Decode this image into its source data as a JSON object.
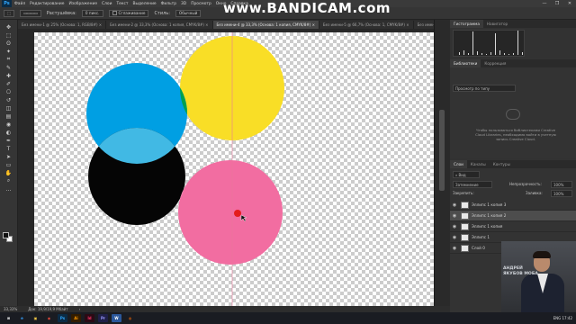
{
  "app": {
    "logo": "Ps",
    "window_controls": [
      "—",
      "❐",
      "✕"
    ]
  },
  "watermark": {
    "prefix": "www.",
    "brand": "BANDICAM",
    "suffix": ".com"
  },
  "menu": [
    "Файл",
    "Редактирование",
    "Изображение",
    "Слои",
    "Текст",
    "Выделение",
    "Фильтр",
    "3D",
    "Просмотр",
    "Окно",
    "Справка"
  ],
  "options_bar": {
    "tool_icon": "marquee-icon",
    "feather_label": "Растушёвка:",
    "feather_value": "0 пикс.",
    "style_label": "Стиль:",
    "style_value": "Обычный",
    "smooth_label": "Сглаживание",
    "select_mask": "Выделение и маска..."
  },
  "tabs": [
    {
      "label": "Без имени-1 @ 25% (Основа: 1, RGB/8#) ×",
      "active": false
    },
    {
      "label": "Без имени-2 @ 33,3% (Основа: 1 копия, CMYK/8#) ×",
      "active": false
    },
    {
      "label": "Без имени-4 @ 33,3% (Основа: 1 копия, CMYK/8#) ×",
      "active": true
    },
    {
      "label": "Без имени-5 @ 66,7% (Основа: 1, CMYK/8#) ×",
      "active": false
    },
    {
      "label": "Без имени-6 @ 66,7% (Основа: 1, CMYK/8#) ×",
      "active": false
    }
  ],
  "tools": [
    "move-icon",
    "marquee-icon",
    "lasso-icon",
    "magic-wand-icon",
    "crop-icon",
    "eyedropper-icon",
    "healing-icon",
    "brush-icon",
    "stamp-icon",
    "history-brush-icon",
    "eraser-icon",
    "gradient-icon",
    "blur-icon",
    "dodge-icon",
    "pen-icon",
    "type-icon",
    "path-select-icon",
    "shape-icon",
    "hand-icon",
    "zoom-icon",
    "more-icon"
  ],
  "tool_glyphs": [
    "✥",
    "⬚",
    "ʘ",
    "✦",
    "⌗",
    "✎",
    "✚",
    "✐",
    "⎔",
    "↺",
    "◫",
    "▤",
    "◉",
    "◐",
    "✒",
    "T",
    "➤",
    "▭",
    "✋",
    "⌕",
    "…"
  ],
  "circles": [
    {
      "name": "yellow",
      "color": "#f9de26"
    },
    {
      "name": "cyan",
      "color": "#009fe3"
    },
    {
      "name": "green-overlap",
      "color": "#00a050"
    },
    {
      "name": "black",
      "color": "#050505"
    },
    {
      "name": "light-cyan-overlap",
      "color": "#41b9e4"
    },
    {
      "name": "magenta",
      "color": "#f26da1"
    },
    {
      "name": "light-magenta-overlap",
      "color": "#f5a8c8"
    }
  ],
  "status": {
    "zoom": "33,33%",
    "doc": "Док: 19,9/19,9 Мбайт",
    "arrow": "›"
  },
  "panels": {
    "top_tabs": [
      "Гистограмма",
      "Навигатор"
    ],
    "libs_tabs": [
      "Библиотеки",
      "Коррекция"
    ],
    "libs_search_placeholder": "Просмотр по типу",
    "libs_message": "Чтобы пользоваться библиотеками Creative Cloud Libraries, необходимо войти в учетную запись Creative Cloud.",
    "layers_tabs": [
      "Слои",
      "Каналы",
      "Контуры"
    ],
    "layers_filter": "Вид",
    "blend_mode": "Затемнение",
    "opacity_label": "Непрозрачность:",
    "opacity_value": "100%",
    "lock_label": "Закрепить:",
    "fill_label": "Заливка:",
    "fill_value": "100%",
    "layers": [
      {
        "name": "Эллипс 1 копия 3",
        "selected": false
      },
      {
        "name": "Эллипс 1 копия 2",
        "selected": true
      },
      {
        "name": "Эллипс 1 копия",
        "selected": false
      },
      {
        "name": "Эллипс 1",
        "selected": false
      },
      {
        "name": "Слой 0",
        "selected": false
      }
    ]
  },
  "taskbar": {
    "apps": [
      {
        "label": "⊞",
        "color": "#ffffff",
        "bg": "#1a1c22"
      },
      {
        "label": "e",
        "color": "#35a0ff",
        "bg": "#1a1c22"
      },
      {
        "label": "▣",
        "color": "#f2c744",
        "bg": "#1a1c22"
      },
      {
        "label": "◉",
        "color": "#e94b3c",
        "bg": "#1a1c22"
      },
      {
        "label": "Ps",
        "color": "#31a8ff",
        "bg": "#0b2b45"
      },
      {
        "label": "Ai",
        "color": "#ff9a00",
        "bg": "#331c00"
      },
      {
        "label": "Id",
        "color": "#ff3366",
        "bg": "#2b0a15"
      },
      {
        "label": "Pr",
        "color": "#9999ff",
        "bg": "#1f1f48"
      },
      {
        "label": "W",
        "color": "#ffffff",
        "bg": "#2b579a"
      },
      {
        "label": "◍",
        "color": "#ff6a00",
        "bg": "#1a1c22"
      }
    ],
    "tray": "ENG  17:42"
  },
  "presenter": {
    "line1": "АНДРЕЙ",
    "line2": "ЯКУБОВ МОБА"
  }
}
